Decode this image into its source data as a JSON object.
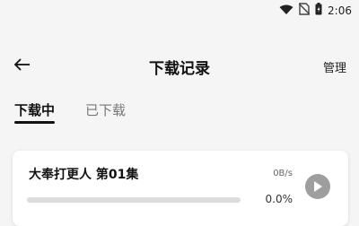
{
  "status_bar": {
    "time": "2:06",
    "icons": [
      "wifi-icon",
      "no-sim-icon",
      "battery-icon"
    ]
  },
  "header": {
    "title": "下载记录",
    "manage_label": "管理",
    "back_icon": "arrow-left-icon"
  },
  "tabs": [
    {
      "label": "下载中",
      "active": true
    },
    {
      "label": "已下载",
      "active": false
    }
  ],
  "downloads": [
    {
      "title": "大奉打更人 第01集",
      "speed": "0B/s",
      "percent": "0.0%",
      "progress": 0.0,
      "action_icon": "play-icon"
    }
  ],
  "colors": {
    "background": "#f5f5f5",
    "card": "#ffffff",
    "accent": "#111111",
    "inactive_tab": "#777777",
    "progress_track": "#dcdcdc",
    "play_button": "#9e9e9e"
  }
}
